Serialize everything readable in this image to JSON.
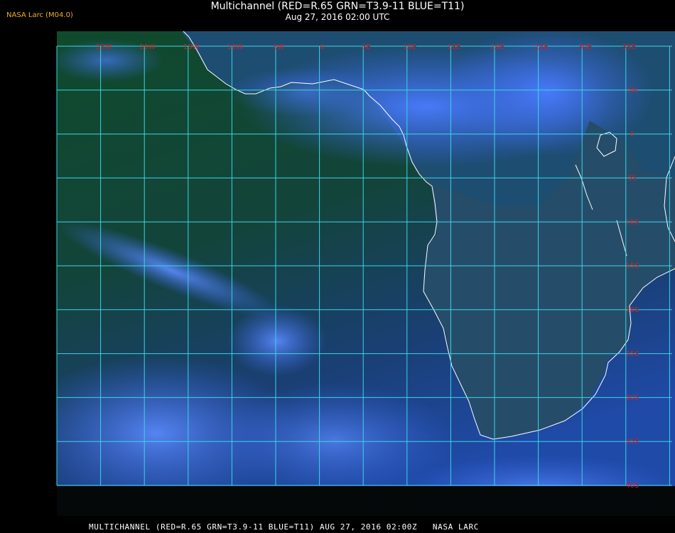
{
  "header": {
    "title": "Multichannel (RED=R.65 GRN=T3.9-11 BLUE=T11)",
    "subtitle": "Aug 27, 2016 02:00 UTC",
    "source_badge": "NASA Larc (M04.0)"
  },
  "map": {
    "lon_labels": [
      "25W",
      "20W",
      "15W",
      "10W",
      "5W",
      "0",
      "5E",
      "10E",
      "15E",
      "20E",
      "25E",
      "30E",
      "35E"
    ],
    "lat_labels": [
      "5N",
      "0",
      "5S",
      "10S",
      "15S",
      "20S",
      "25S",
      "30S",
      "35S",
      "40S"
    ]
  },
  "footer": {
    "caption": "MULTICHANNEL (RED=R.65 GRN=T3.9-11 BLUE=T11) AUG 27, 2016 02:00Z   NASA LARC"
  },
  "colors": {
    "grid": "#38d6e6",
    "label": "#d02020",
    "coast": "#ffffff",
    "ocean_dark": "#0d3c2a",
    "ocean_blue": "#1d4f9a",
    "cloud": "#3a6cf5",
    "land": "#234f66",
    "badge": "#f0b020"
  }
}
